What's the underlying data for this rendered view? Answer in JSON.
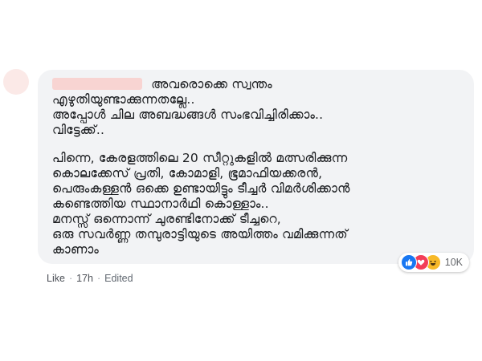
{
  "comment": {
    "paragraphs": [
      [
        "അവരൊക്കെ സ്വന്തം",
        "എഴുതിയുണ്ടാക്കുന്നതല്ലേ..",
        "അപ്പോൾ ചില അബദ്ധങ്ങൾ സംഭവിച്ചിരിക്കാം..",
        "വിട്ടേക്ക്.."
      ],
      [
        "പിന്നെ, കേരളത്തിലെ 20 സീറ്റുകളിൽ മത്സരിക്കുന്ന",
        "കൊലക്കേസ് പ്രതി, കോമാളി, ഭൂമാഫിയക്കരൻ,",
        "പെരുംകള്ളൻ ഒക്കെ ഉണ്ടായിട്ടും ടീച്ചർ വിമർശിക്കാൻ",
        "കണ്ടെത്തിയ സ്ഥാനാർഥി കൊള്ളാം..",
        "മനസ്സ് ഒന്നൊന്ന് ചുരണ്ടിനോക്ക് ടീച്ചറെ,",
        "ഒരു സവർണ്ണ തമ്പുരാട്ടിയുടെ അയിത്തം വമിക്കുന്നത്",
        "കാണാം"
      ]
    ]
  },
  "reactions": {
    "icons": [
      "like-reaction-icon",
      "love-reaction-icon",
      "haha-reaction-icon"
    ],
    "count": "10K",
    "colors": {
      "like": "#1877f2",
      "love": "#f33e58",
      "haha": "#f7b928"
    }
  },
  "meta": {
    "like_label": "Like",
    "separator": "·",
    "time": "17h",
    "edited": "Edited"
  }
}
